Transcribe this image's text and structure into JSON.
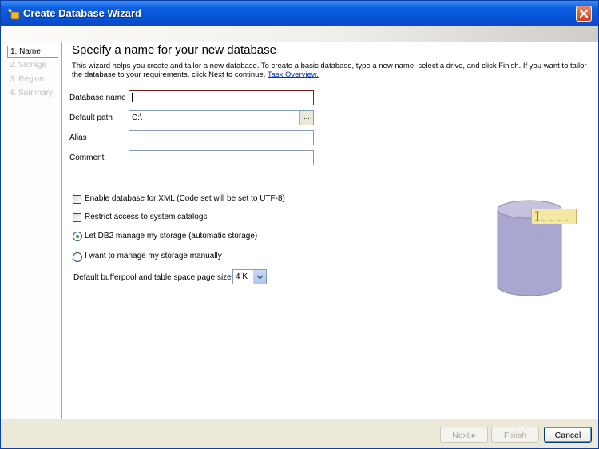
{
  "window": {
    "title": "Create Database Wizard",
    "icon": "db2-wizard-icon",
    "close_icon": "close-icon"
  },
  "nav": {
    "steps": [
      "1. Name",
      "2. Storage",
      "3. Region",
      "4. Summary"
    ],
    "active_index": 0
  },
  "page": {
    "heading": "Specify a name for your new database",
    "description": "This wizard helps you create and tailor a new database. To create a basic database, type a new name, select a drive, and click Finish. If you want to tailor the database to your requirements, click Next to continue.",
    "link": "Task Overview."
  },
  "form": {
    "database_name": {
      "label": "Database name",
      "value": ""
    },
    "default_path": {
      "label": "Default path",
      "value": "C:\\",
      "browse": "..."
    },
    "alias": {
      "label": "Alias",
      "value": ""
    },
    "comment": {
      "label": "Comment",
      "value": ""
    }
  },
  "options": {
    "xml": {
      "label": "Enable database for XML (Code set will be set to UTF-8)",
      "checked": false
    },
    "restrict": {
      "label": "Restrict access to system catalogs",
      "checked": false
    },
    "auto_storage": {
      "label": "Let DB2 manage my storage (automatic storage)",
      "selected": true
    },
    "manual_storage": {
      "label": "I want to manage my storage manually",
      "selected": false
    },
    "pagesize": {
      "label": "Default bufferpool and table space page size",
      "value": "4 K"
    }
  },
  "illustration": {
    "icon": "database-cylinder-icon",
    "tooltip_icon": "text-cursor-icon",
    "tooltip_text": "_ _ _ _ _"
  },
  "footer": {
    "next": "Next ▸",
    "finish": "Finish",
    "cancel": "Cancel"
  },
  "colors": {
    "titlebar": "#0a5ee0",
    "window_bg": "#ece9d8",
    "link": "#0033cc",
    "focus_border": "#7a1f1f",
    "cylinder": "#a9a6cf"
  }
}
